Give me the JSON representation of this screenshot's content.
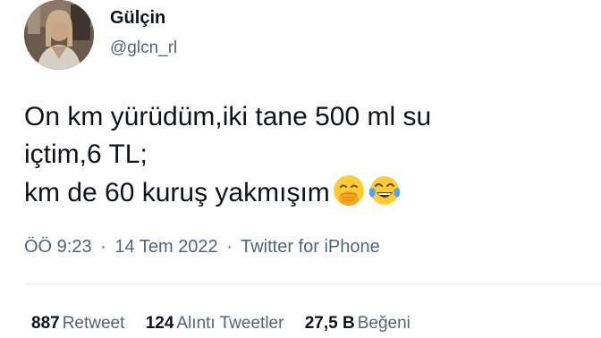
{
  "user": {
    "display_name": "Gülçin",
    "handle": "@glcn_rl"
  },
  "tweet": {
    "lines": [
      "On km yürüdüm,iki tane 500 ml su",
      "içtim,6 TL;",
      "km de 60 kuruş yakmışım"
    ],
    "emojis": [
      "face-with-hand-over-mouth-emoji",
      "face-with-tears-of-joy-emoji"
    ]
  },
  "meta": {
    "time": "ÖÖ 9:23",
    "separator": "·",
    "date": "14 Tem 2022",
    "source": "Twitter for iPhone"
  },
  "stats": {
    "retweets": {
      "count": "887",
      "label": "Retweet"
    },
    "quotes": {
      "count": "124",
      "label": "Alıntı Tweetler"
    },
    "likes": {
      "count": "27,5 B",
      "label": "Beğeni"
    }
  }
}
